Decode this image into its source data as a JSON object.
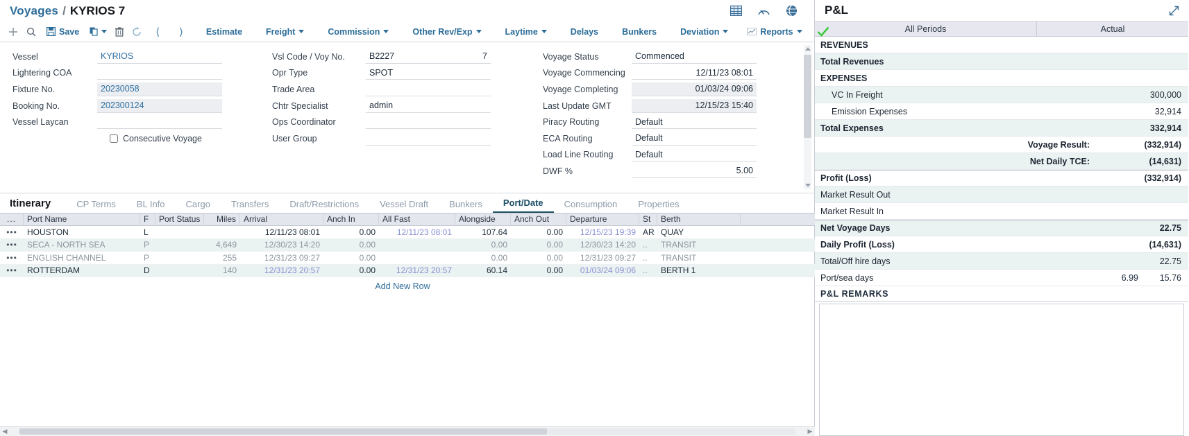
{
  "header": {
    "breadcrumb_root": "Voyages",
    "breadcrumb_sep": "/",
    "breadcrumb_current": "KYRIOS 7",
    "icons": [
      "grid-icon",
      "gauge-icon",
      "globe-icon"
    ]
  },
  "toolbar": {
    "add_label": "+",
    "save_label": "Save",
    "items": [
      {
        "label": "Estimate",
        "caret": false
      },
      {
        "label": "Freight",
        "caret": true
      },
      {
        "label": "Commission",
        "caret": true
      },
      {
        "label": "Other Rev/Exp",
        "caret": true
      },
      {
        "label": "Laytime",
        "caret": true
      },
      {
        "label": "Delays",
        "caret": false
      },
      {
        "label": "Bunkers",
        "caret": false
      },
      {
        "label": "Deviation",
        "caret": true
      },
      {
        "label": "Reports",
        "caret": true
      }
    ],
    "check_icon": "checkmark-icon"
  },
  "form": {
    "col1": [
      {
        "label": "Vessel",
        "value": "KYRIOS",
        "style": "blue"
      },
      {
        "label": "Lightering COA",
        "value": "",
        "style": "plain"
      },
      {
        "label": "Fixture No.",
        "value": "20230058",
        "style": "readonly-blue"
      },
      {
        "label": "Booking No.",
        "value": "202300124",
        "style": "readonly-blue"
      },
      {
        "label": "Vessel Laycan",
        "value": "",
        "style": "split"
      }
    ],
    "consecutive_voyage_label": "Consecutive Voyage",
    "consecutive_voyage_checked": false,
    "col2": [
      {
        "label": "Vsl Code / Voy No.",
        "value": "B2227",
        "value2": "7"
      },
      {
        "label": "Opr Type",
        "value": "SPOT",
        "value2": ""
      },
      {
        "label": "Trade Area",
        "value": "",
        "value2": ""
      },
      {
        "label": "Chtr Specialist",
        "value": "admin",
        "value2": ""
      },
      {
        "label": "Ops Coordinator",
        "value": "",
        "value2": ""
      },
      {
        "label": "User Group",
        "value": "",
        "value2": ""
      }
    ],
    "col3": [
      {
        "label": "Voyage Status",
        "value": "Commenced",
        "align": "left",
        "readonly": false
      },
      {
        "label": "Voyage Commencing",
        "value": "12/11/23 08:01",
        "align": "right",
        "readonly": false
      },
      {
        "label": "Voyage Completing",
        "value": "01/03/24 09:06",
        "align": "right",
        "readonly": true
      },
      {
        "label": "Last Update GMT",
        "value": "12/15/23 15:40",
        "align": "right",
        "readonly": true
      },
      {
        "label": "Piracy Routing",
        "value": "Default",
        "align": "left",
        "readonly": false,
        "split": true
      },
      {
        "label": "ECA Routing",
        "value": "Default",
        "align": "left",
        "readonly": false,
        "split": true
      },
      {
        "label": "Load Line Routing",
        "value": "Default",
        "align": "left",
        "readonly": false,
        "split": true
      },
      {
        "label": "DWF %",
        "value": "5.00",
        "align": "right",
        "readonly": false
      }
    ]
  },
  "tabs": {
    "primary": "Itinerary",
    "items": [
      {
        "label": "CP Terms",
        "active": false
      },
      {
        "label": "BL Info",
        "active": false
      },
      {
        "label": "Cargo",
        "active": false
      },
      {
        "label": "Transfers",
        "active": false
      },
      {
        "label": "Draft/Restrictions",
        "active": false
      },
      {
        "label": "Vessel Draft",
        "active": false
      },
      {
        "label": "Bunkers",
        "active": false
      },
      {
        "label": "Port/Date",
        "active": true
      },
      {
        "label": "Consumption",
        "active": false
      },
      {
        "label": "Properties",
        "active": false
      }
    ]
  },
  "itinerary": {
    "columns": [
      "...",
      "Port Name",
      "F",
      "Port Status",
      "Miles",
      "Arrival",
      "Anch In",
      "All Fast",
      "Alongside",
      "Anch Out",
      "Departure",
      "St",
      "Berth"
    ],
    "rows": [
      {
        "dots": "•••",
        "port": "HOUSTON",
        "f": "L",
        "status": "",
        "miles": "",
        "arrival": "12/11/23 08:01",
        "anch_in": "0.00",
        "all_fast": "12/11/23 08:01",
        "alongside": "107.64",
        "anch_out": "0.00",
        "departure": "12/15/23 19:39",
        "st": "AR",
        "berth": "QUAY",
        "dim": false
      },
      {
        "dots": "•••",
        "port": "SECA - NORTH SEA",
        "f": "P",
        "status": "",
        "miles": "4,649",
        "arrival": "12/30/23 14:20",
        "anch_in": "0.00",
        "all_fast": "",
        "alongside": "0.00",
        "anch_out": "0.00",
        "departure": "12/30/23 14:20",
        "st": "..",
        "berth": "TRANSIT",
        "dim": true
      },
      {
        "dots": "•••",
        "port": "ENGLISH CHANNEL",
        "f": "P",
        "status": "",
        "miles": "255",
        "arrival": "12/31/23 09:27",
        "anch_in": "0.00",
        "all_fast": "",
        "alongside": "0.00",
        "anch_out": "0.00",
        "departure": "12/31/23 09:27",
        "st": "..",
        "berth": "TRANSIT",
        "dim": true
      },
      {
        "dots": "•••",
        "port": "ROTTERDAM",
        "f": "D",
        "status": "",
        "miles": "140",
        "arrival": "12/31/23 20:57",
        "anch_in": "0.00",
        "all_fast": "12/31/23 20:57",
        "alongside": "60.14",
        "anch_out": "0.00",
        "departure": "01/03/24 09:06",
        "st": "..",
        "berth": "BERTH 1",
        "dim": false
      }
    ],
    "add_new_row": "Add New Row"
  },
  "pnl": {
    "title": "P&L",
    "expand_icon": "expand-diagonal-icon",
    "period_all": "All Periods",
    "period_actual": "Actual",
    "rows": [
      {
        "label": "REVENUES",
        "value": "",
        "bold": true,
        "alt": false,
        "indent": false,
        "right": false
      },
      {
        "label": "Total Revenues",
        "value": "",
        "bold": true,
        "alt": true,
        "indent": false,
        "right": false
      },
      {
        "label": "EXPENSES",
        "value": "",
        "bold": true,
        "alt": false,
        "indent": false,
        "right": false
      },
      {
        "label": "VC In Freight",
        "value": "300,000",
        "bold": false,
        "alt": true,
        "indent": true,
        "right": false
      },
      {
        "label": "Emission Expenses",
        "value": "32,914",
        "bold": false,
        "alt": false,
        "indent": true,
        "right": false
      },
      {
        "label": "Total Expenses",
        "value": "332,914",
        "bold": true,
        "alt": true,
        "indent": false,
        "right": false
      },
      {
        "label": "Voyage Result:",
        "value": "(332,914)",
        "bold": true,
        "alt": false,
        "indent": false,
        "right": true
      },
      {
        "label": "Net Daily TCE:",
        "value": "(14,631)",
        "bold": true,
        "alt": true,
        "indent": false,
        "right": true
      }
    ],
    "rows2": [
      {
        "label": "Profit (Loss)",
        "value": "(332,914)",
        "bold": true,
        "alt": false
      },
      {
        "label": "Market Result Out",
        "value": "",
        "bold": false,
        "alt": true
      },
      {
        "label": "Market Result In",
        "value": "",
        "bold": false,
        "alt": false
      }
    ],
    "rows3": [
      {
        "label": "Net Voyage Days",
        "value": "22.75",
        "bold": true,
        "alt": true
      },
      {
        "label": "Daily Profit (Loss)",
        "value": "(14,631)",
        "bold": true,
        "alt": false
      },
      {
        "label": "Total/Off hire days",
        "value": "22.75",
        "bold": false,
        "alt": true
      }
    ],
    "port_sea_row": {
      "label": "Port/sea days",
      "value1": "6.99",
      "value2": "15.76"
    },
    "remarks_title": "P&L REMARKS",
    "remarks_value": ""
  }
}
